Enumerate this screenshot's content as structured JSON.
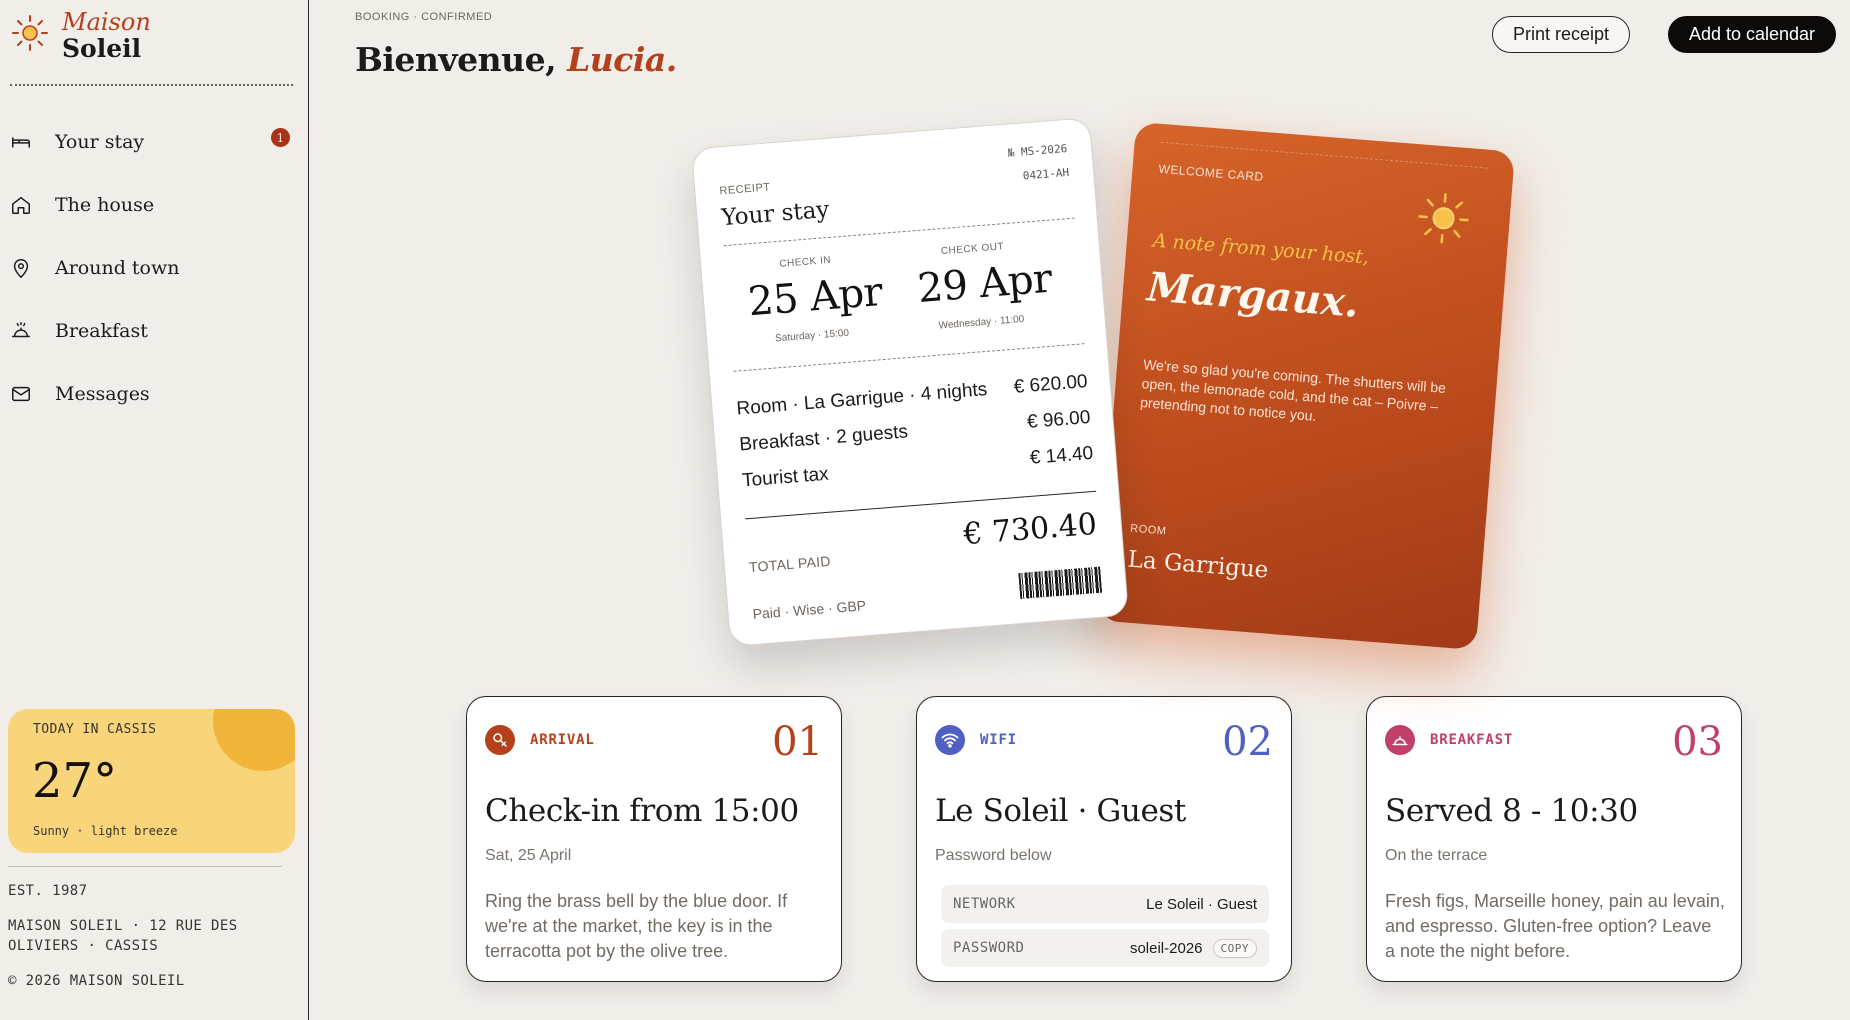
{
  "brand": {
    "top": "Maison",
    "bottom": "Soleil"
  },
  "nav": {
    "items": [
      {
        "label": "Your stay",
        "badge": "1"
      },
      {
        "label": "The house"
      },
      {
        "label": "Around town"
      },
      {
        "label": "Breakfast"
      },
      {
        "label": "Messages"
      }
    ]
  },
  "weather": {
    "label": "TODAY IN CASSIS",
    "temp": "27°",
    "desc": "Sunny · light breeze"
  },
  "footer": {
    "est": "EST. 1987",
    "address": "MAISON SOLEIL · 12 RUE DES OLIVIERS · CASSIS",
    "copyright": "© 2026 MAISON SOLEIL"
  },
  "header": {
    "breadcrumb": "BOOKING · CONFIRMED",
    "greeting": "Bienvenue,",
    "name": "Lucia.",
    "print_label": "Print receipt",
    "calendar_label": "Add to calendar"
  },
  "receipt": {
    "label": "RECEIPT",
    "number": "№ MS-2026",
    "code": "0421-AH",
    "title": "Your stay",
    "checkin_label": "CHECK IN",
    "checkin_date": "25 Apr",
    "checkin_sub": "Saturday · 15:00",
    "checkout_label": "CHECK OUT",
    "checkout_date": "29 Apr",
    "checkout_sub": "Wednesday · 11:00",
    "lines": [
      {
        "label": "Room · La Garrigue · 4 nights",
        "amount": "€ 620.00"
      },
      {
        "label": "Breakfast · 2 guests",
        "amount": "€ 96.00"
      },
      {
        "label": "Tourist tax",
        "amount": "€ 14.40"
      }
    ],
    "total_label": "TOTAL PAID",
    "total": "€ 730.40",
    "paid": "Paid · Wise · GBP"
  },
  "welcome": {
    "label": "WELCOME CARD",
    "note": "A note from your host,",
    "host": "Margaux.",
    "body": "We're so glad you're coming. The shutters will be open, the lemonade cold, and the cat – Poivre – pretending not to notice you.",
    "room_label": "ROOM",
    "room": "La Garrigue"
  },
  "cards": {
    "arrival": {
      "tag": "ARRIVAL",
      "num": "01",
      "title": "Check-in from 15:00",
      "sub": "Sat, 25 April",
      "body": "Ring the brass bell by the blue door. If we're at the market, the key is in the terracotta pot by the olive tree.",
      "color": "#b5401c"
    },
    "wifi": {
      "tag": "WIFI",
      "num": "02",
      "title": "Le Soleil · Guest",
      "sub": "Password below",
      "network_label": "NETWORK",
      "network": "Le Soleil · Guest",
      "password_label": "PASSWORD",
      "password": "soleil-2026",
      "copy_label": "COPY",
      "color": "#4f5fc4"
    },
    "breakfast": {
      "tag": "BREAKFAST",
      "num": "03",
      "title": "Served 8 - 10:30",
      "sub": "On the terrace",
      "body": "Fresh figs, Marseille honey, pain au levain, and espresso. Gluten-free option? Leave a note the night before.",
      "color": "#c0406a"
    }
  }
}
